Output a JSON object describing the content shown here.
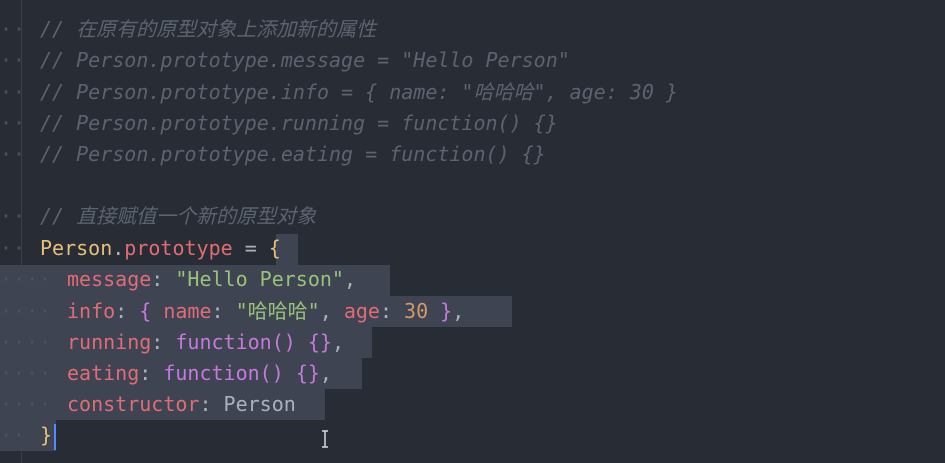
{
  "editor": {
    "lines": [
      {
        "id": "l0",
        "dots": "··",
        "tokens": [
          {
            "t": "// 在原有的原型对象上添加新的属性",
            "c": "c-comment"
          }
        ]
      },
      {
        "id": "l1",
        "dots": "··",
        "tokens": [
          {
            "t": "// Person.prototype.message = \"Hello Person\"",
            "c": "c-comment"
          }
        ]
      },
      {
        "id": "l2",
        "dots": "··",
        "tokens": [
          {
            "t": "// Person.prototype.info = { name: \"哈哈哈\", age: 30 }",
            "c": "c-comment"
          }
        ]
      },
      {
        "id": "l3",
        "dots": "··",
        "tokens": [
          {
            "t": "// Person.prototype.running = function() {}",
            "c": "c-comment"
          }
        ]
      },
      {
        "id": "l4",
        "dots": "··",
        "tokens": [
          {
            "t": "// Person.prototype.eating = function() {}",
            "c": "c-comment"
          }
        ]
      },
      {
        "id": "l5",
        "dots": "",
        "tokens": []
      },
      {
        "id": "l6",
        "dots": "··",
        "tokens": [
          {
            "t": "// 直接赋值一个新的原型对象",
            "c": "c-comment"
          }
        ]
      },
      {
        "id": "l7",
        "dots": "··",
        "tokens": [
          {
            "t": "Person",
            "c": "c-obj"
          },
          {
            "t": ".",
            "c": "c-punc"
          },
          {
            "t": "prototype",
            "c": "c-prop"
          },
          {
            "t": " = ",
            "c": "c-punc"
          },
          {
            "t": "{",
            "c": "c-brace-y"
          }
        ]
      },
      {
        "id": "l8",
        "dots": "····",
        "tokens": [
          {
            "t": "message",
            "c": "c-prop"
          },
          {
            "t": ": ",
            "c": "c-punc"
          },
          {
            "t": "\"Hello Person\"",
            "c": "c-str"
          },
          {
            "t": ",",
            "c": "c-punc"
          }
        ]
      },
      {
        "id": "l9",
        "dots": "····",
        "tokens": [
          {
            "t": "info",
            "c": "c-prop"
          },
          {
            "t": ": ",
            "c": "c-punc"
          },
          {
            "t": "{ ",
            "c": "c-brace"
          },
          {
            "t": "name",
            "c": "c-prop"
          },
          {
            "t": ": ",
            "c": "c-punc"
          },
          {
            "t": "\"哈哈哈\"",
            "c": "c-str"
          },
          {
            "t": ", ",
            "c": "c-punc"
          },
          {
            "t": "age",
            "c": "c-prop"
          },
          {
            "t": ": ",
            "c": "c-punc"
          },
          {
            "t": "30",
            "c": "c-num"
          },
          {
            "t": " }",
            "c": "c-brace"
          },
          {
            "t": ",",
            "c": "c-punc"
          }
        ]
      },
      {
        "id": "l10",
        "dots": "····",
        "tokens": [
          {
            "t": "running",
            "c": "c-prop"
          },
          {
            "t": ": ",
            "c": "c-punc"
          },
          {
            "t": "function",
            "c": "c-fn"
          },
          {
            "t": "() {}",
            "c": "c-brace"
          },
          {
            "t": ",",
            "c": "c-punc"
          }
        ]
      },
      {
        "id": "l11",
        "dots": "····",
        "tokens": [
          {
            "t": "eating",
            "c": "c-prop"
          },
          {
            "t": ": ",
            "c": "c-punc"
          },
          {
            "t": "function",
            "c": "c-fn"
          },
          {
            "t": "() {}",
            "c": "c-brace"
          },
          {
            "t": ",",
            "c": "c-punc"
          }
        ]
      },
      {
        "id": "l12",
        "dots": "····",
        "tokens": [
          {
            "t": "constructor",
            "c": "c-prop"
          },
          {
            "t": ": ",
            "c": "c-punc"
          },
          {
            "t": "Person",
            "c": "c-plain"
          }
        ]
      },
      {
        "id": "l13",
        "dots": "··",
        "tokens": [
          {
            "t": "}",
            "c": "c-brace-y"
          }
        ]
      }
    ]
  },
  "colors": {
    "background": "#282c34",
    "selection": "#3e4451",
    "comment": "#5c6370",
    "string": "#98c379",
    "property": "#e06c75",
    "keyword": "#c678dd",
    "object": "#e5c07b",
    "number": "#d19a66",
    "caret": "#528bff"
  }
}
